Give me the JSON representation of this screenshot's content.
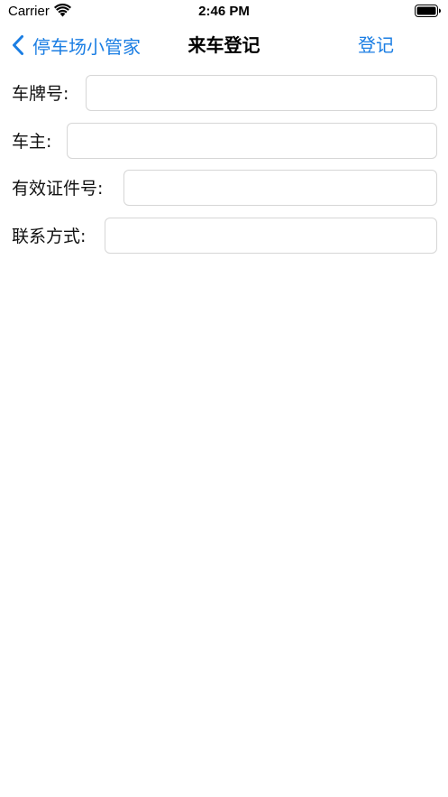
{
  "status_bar": {
    "carrier": "Carrier",
    "time": "2:46 PM",
    "wifi_icon": "wifi-icon",
    "battery_icon": "battery-icon"
  },
  "nav": {
    "back_label": "停车场小管家",
    "back_icon": "chevron-left-icon",
    "title": "来车登记",
    "action_label": "登记"
  },
  "form": {
    "fields": [
      {
        "label": "车牌号:",
        "value": "",
        "placeholder": ""
      },
      {
        "label": "车主:",
        "value": "",
        "placeholder": ""
      },
      {
        "label": "有效证件号:",
        "value": "",
        "placeholder": ""
      },
      {
        "label": "联系方式:",
        "value": "",
        "placeholder": ""
      }
    ]
  },
  "colors": {
    "accent": "#1b7ee3",
    "background": "#ffffff",
    "input_border": "#d6d6d6"
  }
}
